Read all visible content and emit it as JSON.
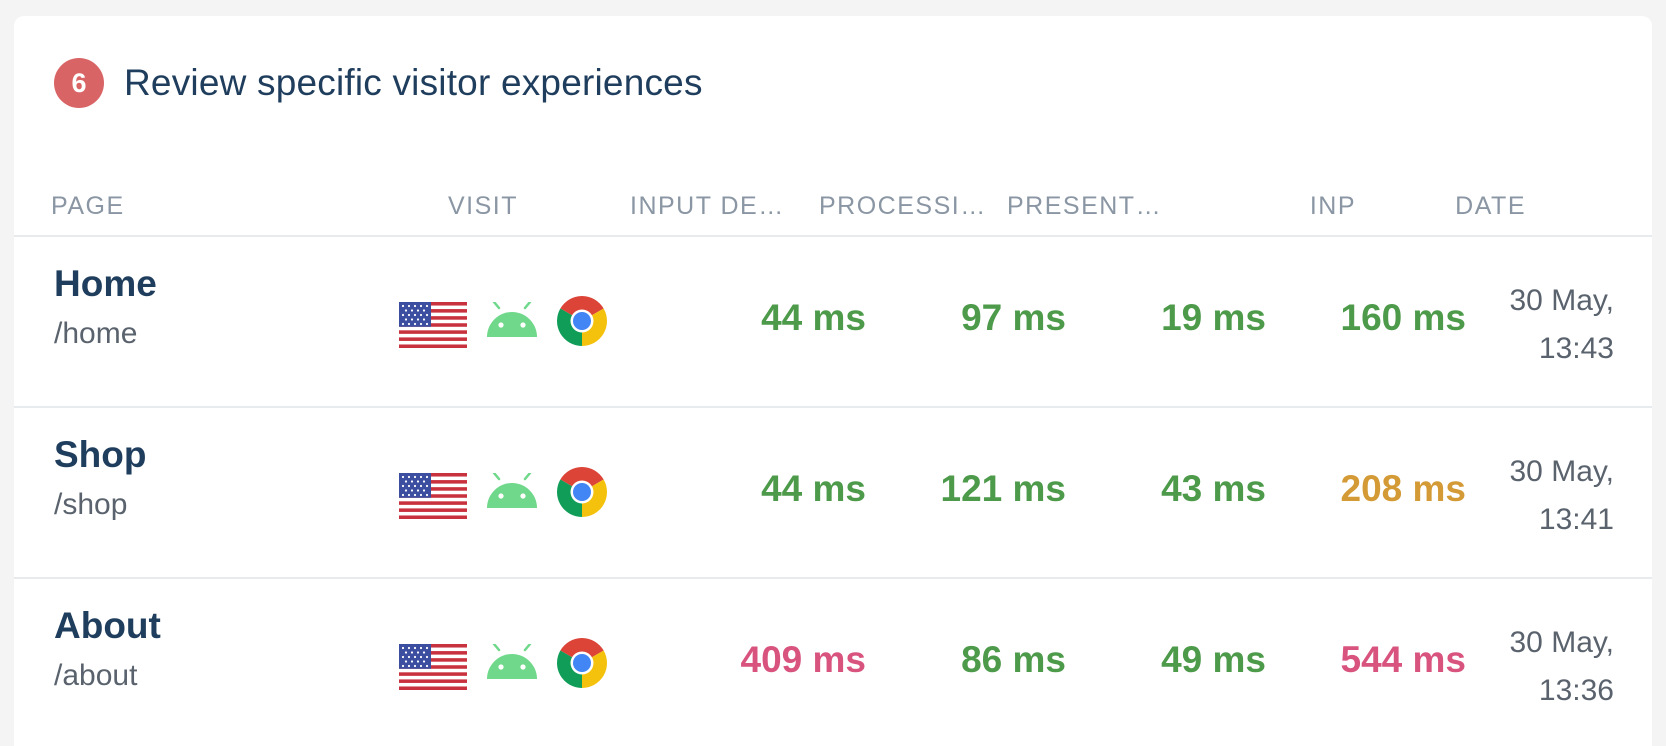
{
  "header": {
    "step": "6",
    "title": "Review specific visitor experiences"
  },
  "columns": {
    "page": "PAGE",
    "visit": "VISIT",
    "input_delay": "INPUT DE…",
    "processing": "PROCESSI…",
    "presentation": "PRESENT…",
    "inp": "INP",
    "date": "DATE"
  },
  "icons": {
    "flag": "us-flag-icon",
    "os": "android-icon",
    "browser": "chrome-icon"
  },
  "colors": {
    "good": "#4c9a4a",
    "needs_improvement": "#d39a36",
    "poor": "#d8547e"
  },
  "rows": [
    {
      "name": "Home",
      "path": "/home",
      "input_delay": "44 ms",
      "processing": "97 ms",
      "presentation": "19 ms",
      "inp": "160 ms",
      "date_line1": "30 May,",
      "date_line2": "13:43"
    },
    {
      "name": "Shop",
      "path": "/shop",
      "input_delay": "44 ms",
      "processing": "121 ms",
      "presentation": "43 ms",
      "inp": "208 ms",
      "date_line1": "30 May,",
      "date_line2": "13:41"
    },
    {
      "name": "About",
      "path": "/about",
      "input_delay": "409 ms",
      "processing": "86 ms",
      "presentation": "49 ms",
      "inp": "544 ms",
      "date_line1": "30 May,",
      "date_line2": "13:36"
    }
  ]
}
